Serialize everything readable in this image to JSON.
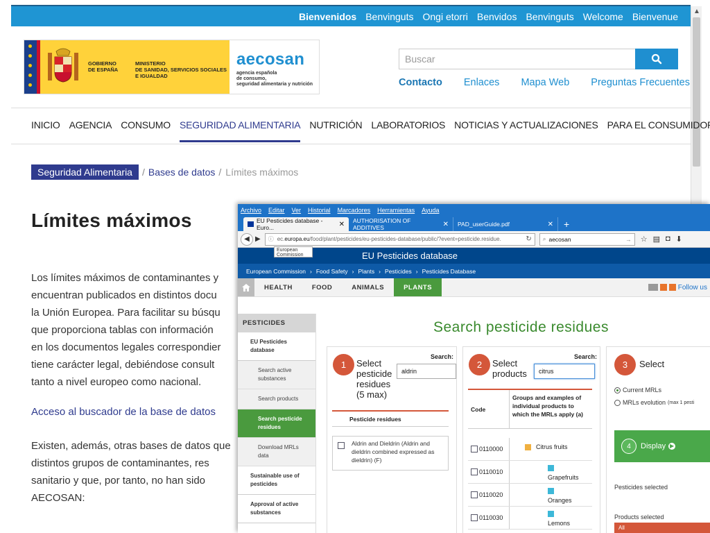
{
  "back": {
    "languages": [
      "Bienvenidos",
      "Benvinguts",
      "Ongi etorri",
      "Benvidos",
      "Benvinguts",
      "Welcome",
      "Bienvenue"
    ],
    "logo": {
      "gov_line1": "GOBIERNO",
      "gov_line2": "DE ESPAÑA",
      "min_line1": "MINISTERIO",
      "min_line2": "DE SANIDAD, SERVICIOS SOCIALES",
      "min_line3": "E IGUALDAD",
      "aecosan": "aecosan",
      "sub1": "agencia española",
      "sub2": "de consumo,",
      "sub3": "seguridad alimentaria y nutrición"
    },
    "search_placeholder": "Buscar",
    "util_links": [
      "Contacto",
      "Enlaces",
      "Mapa Web",
      "Preguntas Frecuentes"
    ],
    "nav": [
      "INICIO",
      "AGENCIA",
      "CONSUMO",
      "SEGURIDAD ALIMENTARIA",
      "NUTRICIÓN",
      "LABORATORIOS",
      "NOTICIAS Y ACTUALIZACIONES",
      "PARA EL CONSUMIDOR"
    ],
    "breadcrumb": {
      "first": "Seguridad Alimentaria",
      "second": "Bases de datos",
      "sep": "/",
      "current": "Límites máximos"
    },
    "title": "Límites máximos",
    "para1_lines": [
      "Los límites máximos de contaminantes y",
      "encuentran publicados en distintos docu",
      "la Unión Europea. Para facilitar su búsqu",
      "que proporciona tablas con información",
      "en los documentos legales correspondier",
      "tiene carácter legal, debiéndose consult",
      "tanto a nivel europeo como nacional."
    ],
    "access_link": "Acceso al buscador de la base de datos",
    "para2_lines": [
      "Existen, además, otras bases de datos que",
      "distintos grupos de contaminantes, res",
      "sanitario y que, por tanto, no han sido",
      "AECOSAN:"
    ]
  },
  "front": {
    "menu": [
      "Archivo",
      "Editar",
      "Ver",
      "Historial",
      "Marcadores",
      "Herramientas",
      "Ayuda"
    ],
    "tabs": [
      {
        "label": "EU Pesticides database - Euro...",
        "close": "✕"
      },
      {
        "label": "AUTHORISATION OF ADDITIVES",
        "close": "✕"
      },
      {
        "label": "PAD_userGuide.pdf",
        "close": "✕"
      }
    ],
    "new_tab": "+",
    "url_prefix": "ec.",
    "url_domain": "europa.eu",
    "url_rest": "/food/plant/pesticides/eu-pesticides-database/public/?event=pesticide.residue.",
    "browser_search": "aecosan",
    "eu_commission_line1": "European",
    "eu_commission_line2": "Commission",
    "eu_title": "EU Pesticides database",
    "crumbs": [
      "European Commission",
      "Food Safety",
      "Plants",
      "Pesticides",
      "Pesticides Database"
    ],
    "crumb_sep": "›",
    "site_tabs": [
      "HEALTH",
      "FOOD",
      "ANIMALS",
      "PLANTS"
    ],
    "follow": "Follow us",
    "sidebar": {
      "head": "PESTICIDES",
      "item1": "EU Pesticides database",
      "subs": [
        "Search active substances",
        "Search products",
        "Search pesticide residues",
        "Download MRLs data"
      ],
      "item2": "Sustainable use of pesticides",
      "item3": "Approval of active substances"
    },
    "main_title": "Search pesticide residues",
    "panel1": {
      "num": "1",
      "title_lines": [
        "Select",
        "pesticide",
        "residues",
        "(5 max)"
      ],
      "search_label": "Search:",
      "search_value": "aldrin",
      "col": "Pesticide residues",
      "row": "Aldrin and Dieldrin (Aldrin and dieldrin combined expressed as dieldrin) (F)"
    },
    "panel2": {
      "num": "2",
      "title_lines": [
        "Select",
        "products"
      ],
      "search_label": "Search:",
      "search_value": "citrus",
      "col_code": "Code",
      "col_groups": "Groups and examples of individual products to which the MRLs apply (a)",
      "rows": [
        {
          "code": "0110000",
          "name": "Citrus fruits"
        },
        {
          "code": "0110010",
          "name": "Grapefruits"
        },
        {
          "code": "0110020",
          "name": "Oranges"
        },
        {
          "code": "0110030",
          "name": "Lemons"
        }
      ]
    },
    "panel3": {
      "num": "3",
      "title": "Select",
      "radio1": "Current MRLs",
      "radio2": "MRLs evolution",
      "radio2_note": "(max 1 pesti",
      "display_num": "4",
      "display": "Display",
      "pest_sel": "Pesticides selected",
      "prod_sel": "Products selected",
      "all": "All"
    },
    "colors": {
      "brand_blue": "#1e73c8",
      "green": "#4a9a3e",
      "step_red": "#d4573a",
      "citrus_orange": "#f0b040",
      "product_cyan": "#3db8d8"
    }
  }
}
